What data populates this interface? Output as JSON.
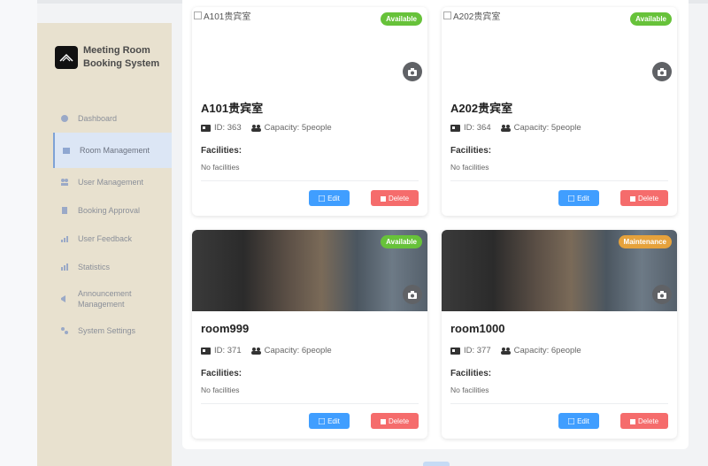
{
  "brand": {
    "title": "Meeting Room Booking System"
  },
  "nav": [
    {
      "label": "Dashboard",
      "icon": "dashboard-icon"
    },
    {
      "label": "Room Management",
      "icon": "room-icon"
    },
    {
      "label": "User Management",
      "icon": "users-icon"
    },
    {
      "label": "Booking Approval",
      "icon": "clipboard-icon"
    },
    {
      "label": "User Feedback",
      "icon": "feedback-icon"
    },
    {
      "label": "Statistics",
      "icon": "chart-icon"
    },
    {
      "label": "Announcement Management",
      "icon": "megaphone-icon"
    },
    {
      "label": "System Settings",
      "icon": "settings-icon"
    }
  ],
  "rooms": [
    {
      "name": "A101贵宾室",
      "image_alt": "A101贵宾室",
      "status": "Available",
      "id": "ID: 363",
      "capacity": "Capacity: 5people",
      "facilities_label": "Facilities:",
      "facilities": "No facilities",
      "edit": "Edit",
      "delete": "Delete"
    },
    {
      "name": "A202贵宾室",
      "image_alt": "A202贵宾室",
      "status": "Available",
      "id": "ID: 364",
      "capacity": "Capacity: 5people",
      "facilities_label": "Facilities:",
      "facilities": "No facilities",
      "edit": "Edit",
      "delete": "Delete"
    },
    {
      "name": "room999",
      "image_alt": "",
      "status": "Available",
      "id": "ID: 371",
      "capacity": "Capacity: 6people",
      "facilities_label": "Facilities:",
      "facilities": "No facilities",
      "edit": "Edit",
      "delete": "Delete"
    },
    {
      "name": "room1000",
      "image_alt": "",
      "status": "Maintenance",
      "id": "ID: 377",
      "capacity": "Capacity: 6people",
      "facilities_label": "Facilities:",
      "facilities": "No facilities",
      "edit": "Edit",
      "delete": "Delete"
    }
  ],
  "colors": {
    "available": "#67c23a",
    "maintenance": "#e6a23c",
    "edit": "#409eff",
    "delete": "#f56c6c",
    "active_nav": "#dce6f5",
    "sidebar": "#e8e1cf"
  }
}
